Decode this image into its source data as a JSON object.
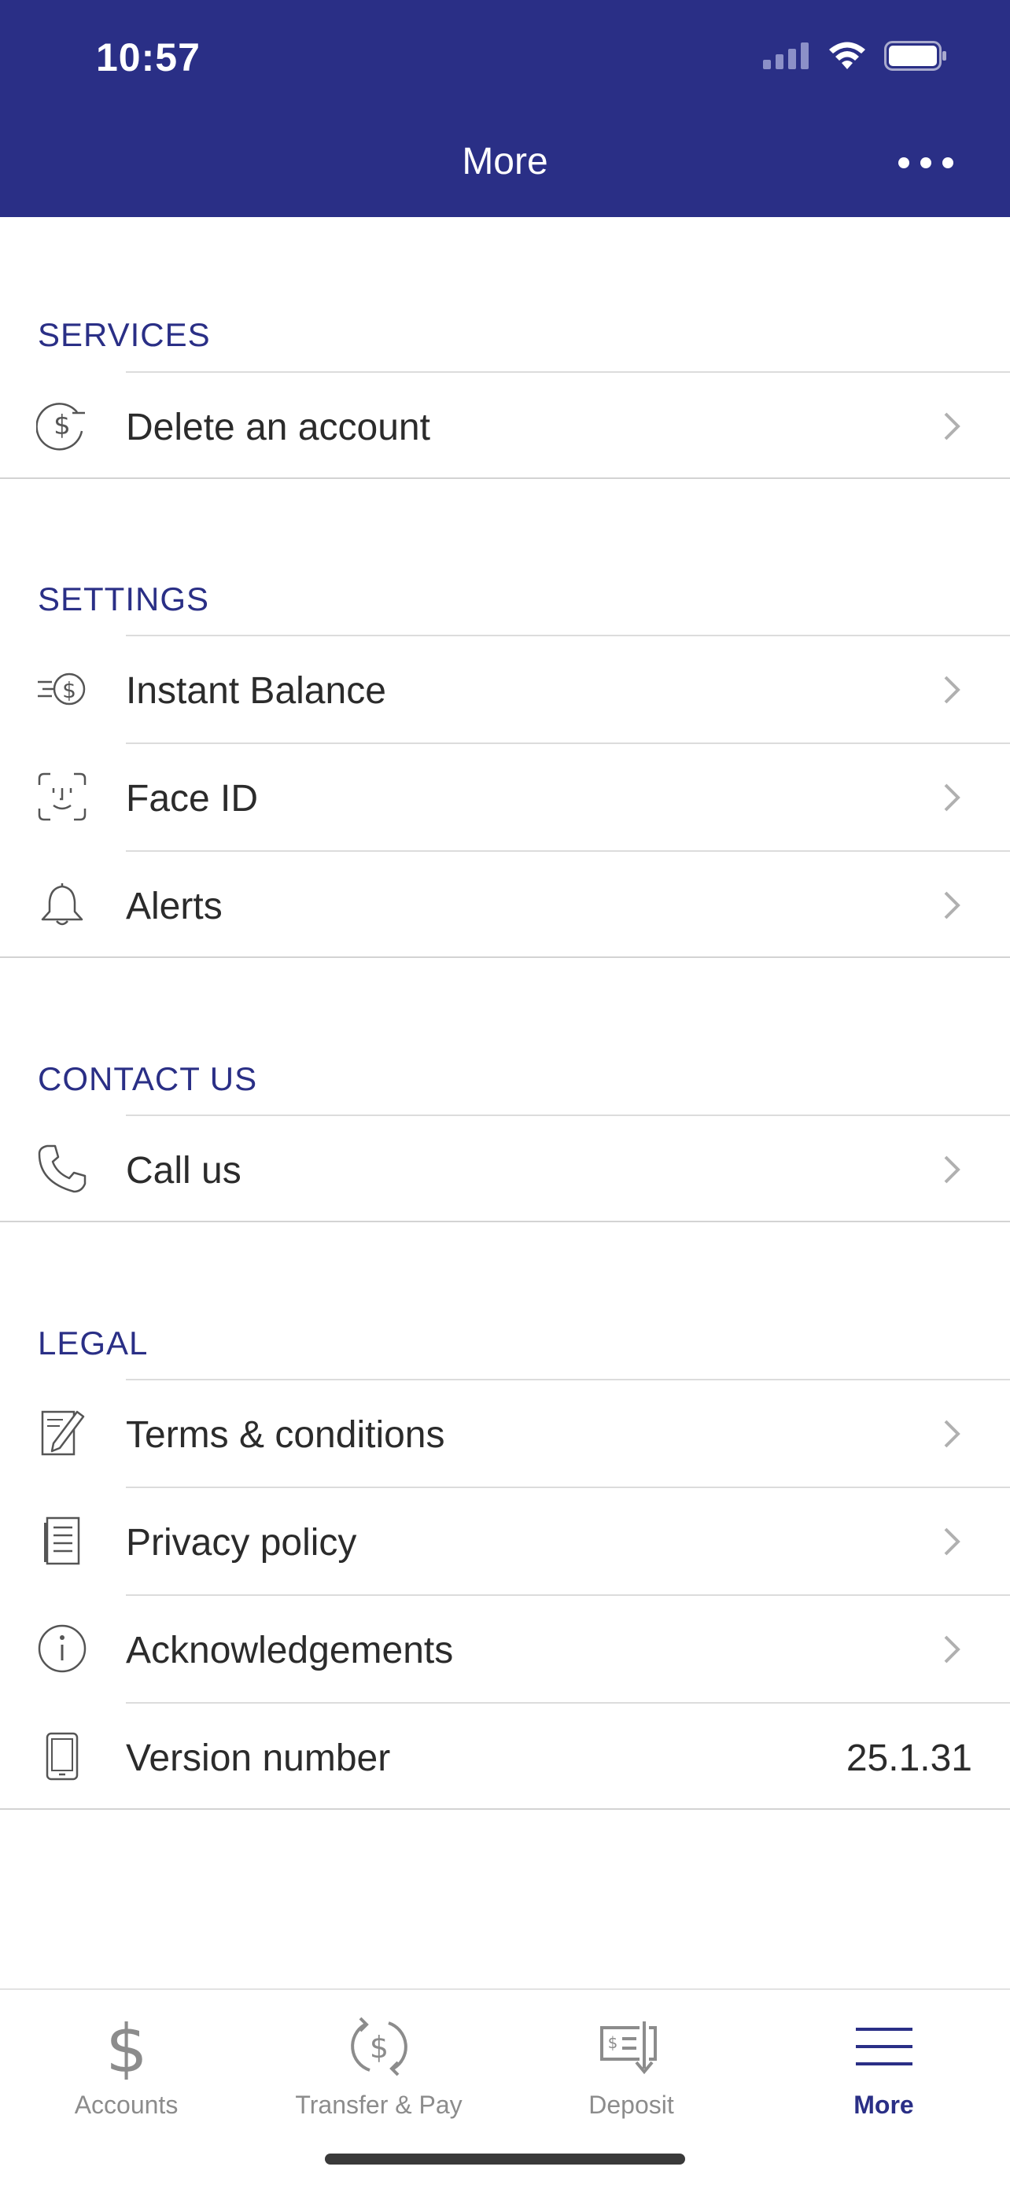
{
  "status_bar": {
    "time": "10:57"
  },
  "header": {
    "title": "More",
    "background": "#2a2f86"
  },
  "sections": {
    "services": {
      "title": "SERVICES",
      "items": [
        {
          "label": "Delete an account",
          "icon": "dollar-circle-icon"
        }
      ]
    },
    "settings": {
      "title": "SETTINGS",
      "items": [
        {
          "label": "Instant Balance",
          "icon": "fast-dollar-icon"
        },
        {
          "label": "Face ID",
          "icon": "face-id-icon"
        },
        {
          "label": "Alerts",
          "icon": "bell-icon"
        }
      ]
    },
    "contact": {
      "title": "CONTACT US",
      "items": [
        {
          "label": "Call us",
          "icon": "phone-icon"
        }
      ]
    },
    "legal": {
      "title": "LEGAL",
      "items": [
        {
          "label": "Terms & conditions",
          "icon": "document-pen-icon"
        },
        {
          "label": "Privacy policy",
          "icon": "document-lines-icon"
        },
        {
          "label": "Acknowledgements",
          "icon": "info-icon"
        },
        {
          "label": "Version number",
          "icon": "phone-device-icon",
          "value": "25.1.31"
        }
      ]
    }
  },
  "tabbar": {
    "tabs": [
      {
        "label": "Accounts",
        "icon": "dollar-icon",
        "active": false
      },
      {
        "label": "Transfer & Pay",
        "icon": "transfer-icon",
        "active": false
      },
      {
        "label": "Deposit",
        "icon": "check-deposit-icon",
        "active": false
      },
      {
        "label": "More",
        "icon": "menu-icon",
        "active": true
      }
    ],
    "active_color": "#2a2f86",
    "inactive_color": "#8c8c8c"
  }
}
